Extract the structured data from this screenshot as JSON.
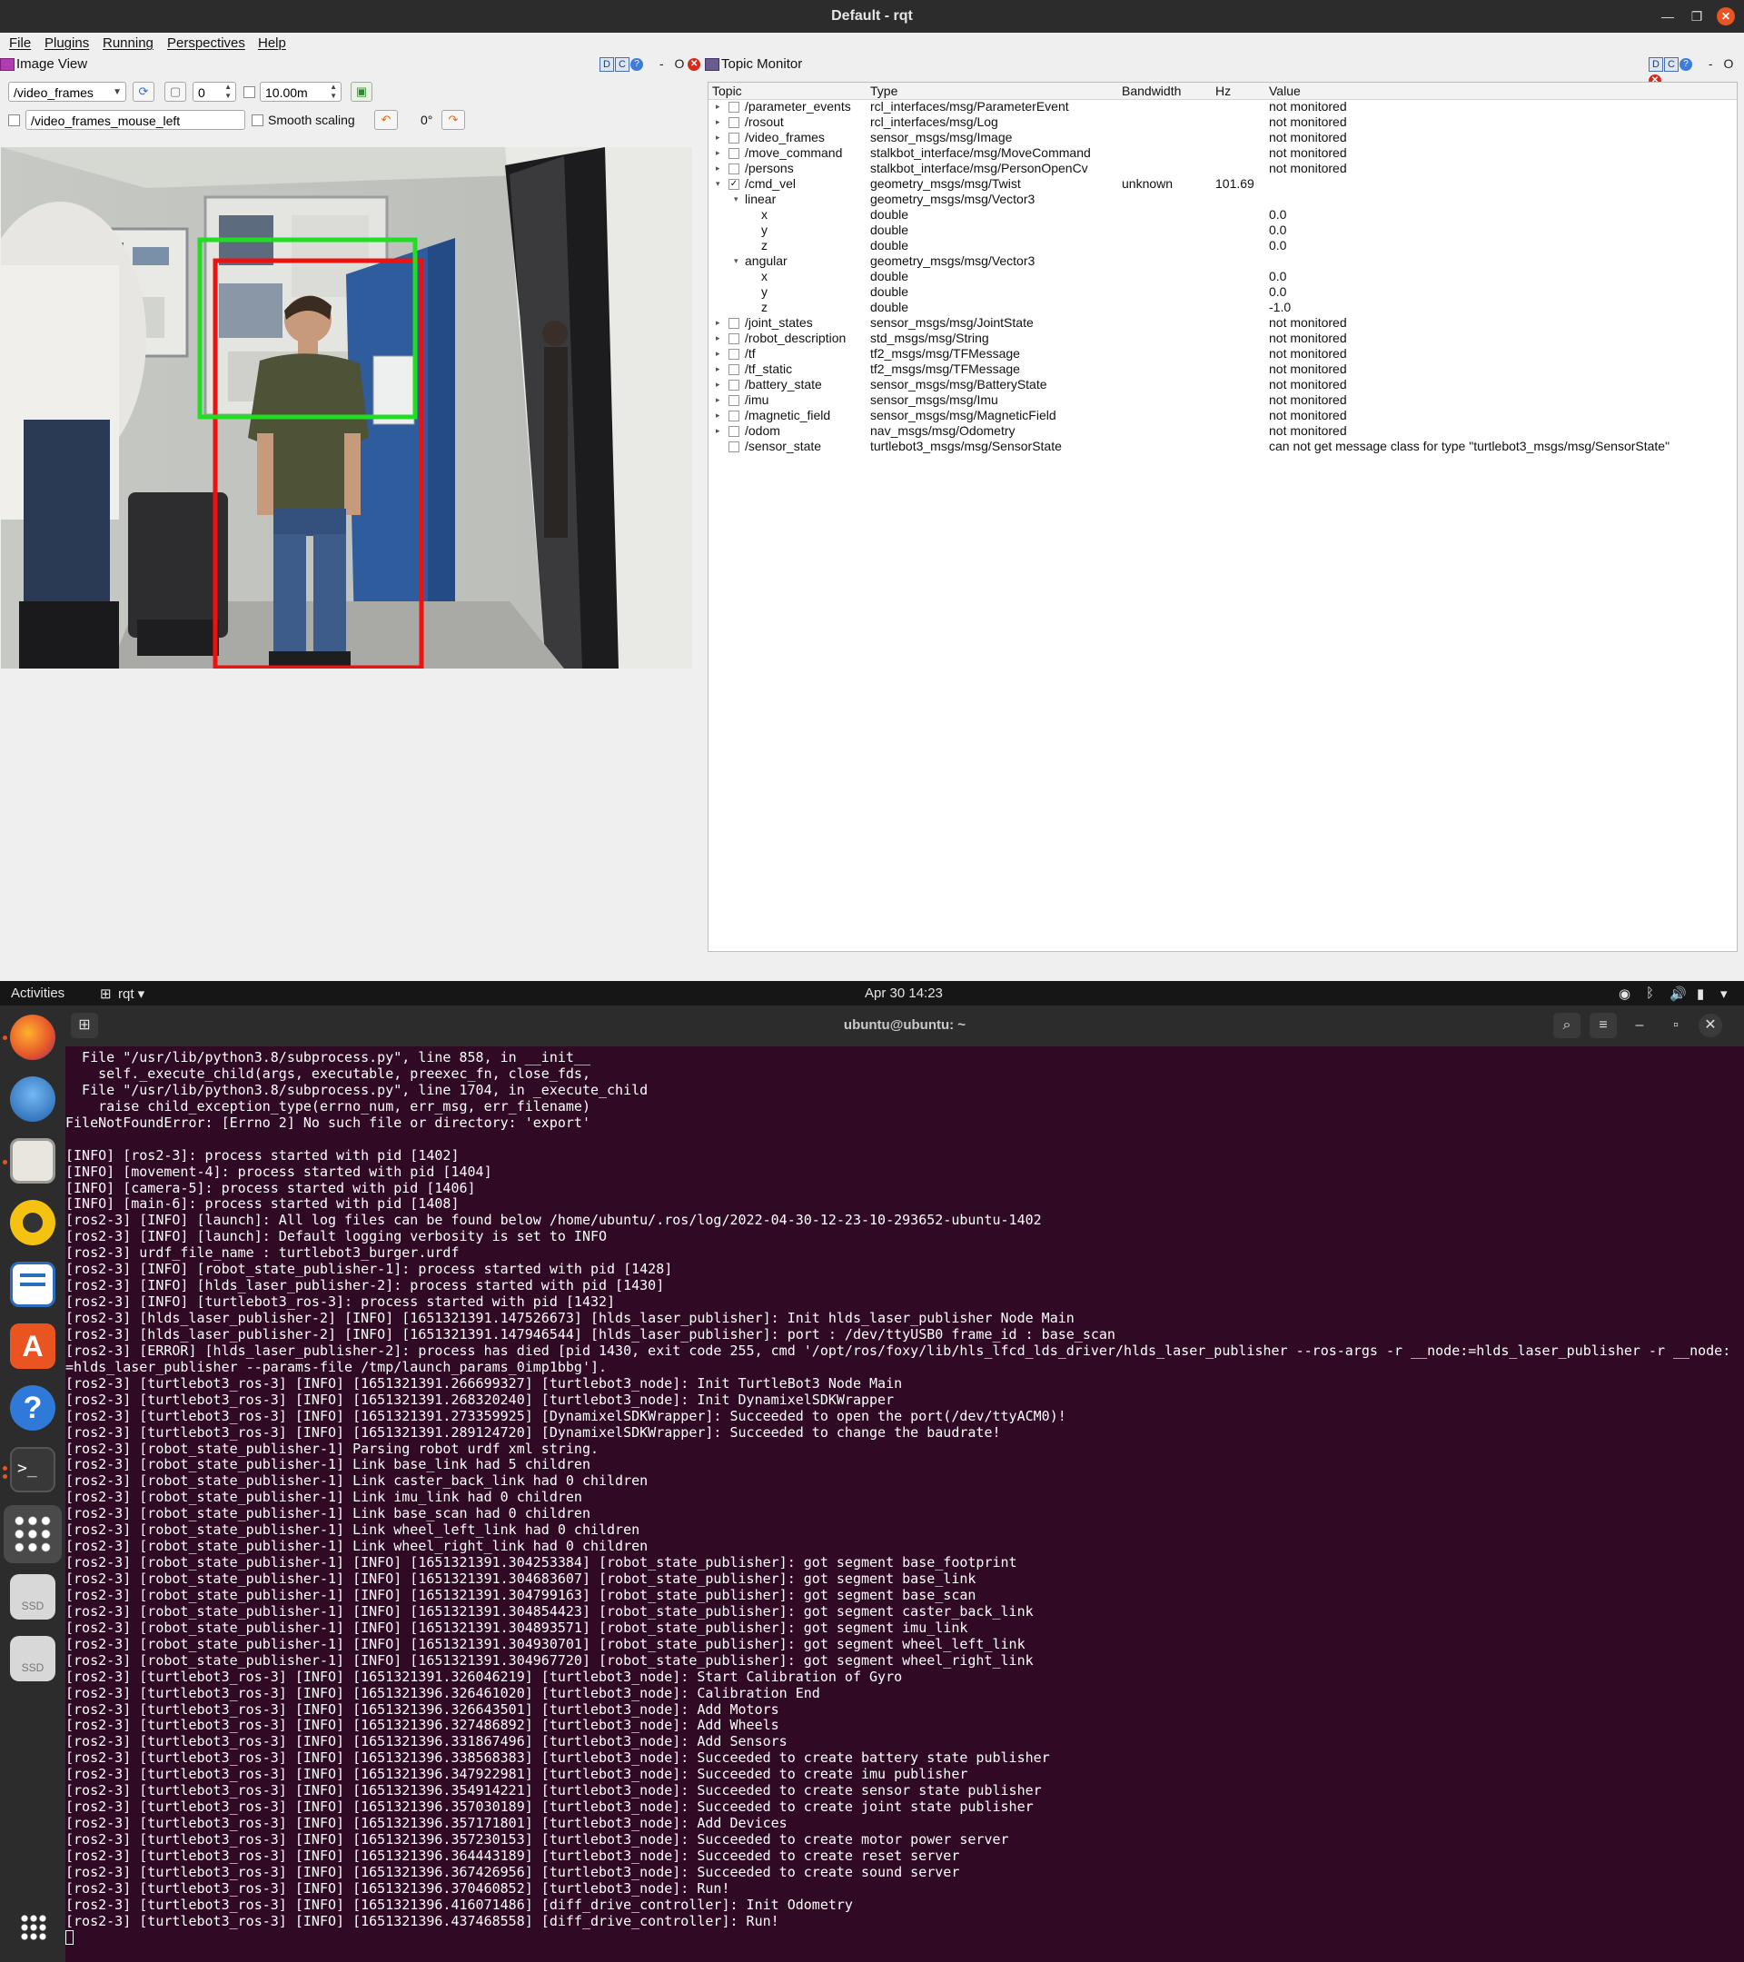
{
  "rqt": {
    "title": "Default - rqt",
    "menu": [
      "File",
      "Plugins",
      "Running",
      "Perspectives",
      "Help"
    ],
    "image_view": {
      "title": "Image View",
      "dock_controls": [
        "D",
        "C",
        "?",
        "-",
        "O"
      ],
      "topic_select": "/video_frames",
      "spin_value": "0",
      "max_range": "10.00m",
      "mouse_topic": "/video_frames_mouse_left",
      "smooth_scaling_label": "Smooth scaling",
      "rotation_label": "0°"
    },
    "topic_monitor": {
      "title": "Topic Monitor",
      "dock_controls": [
        "D",
        "C",
        "?",
        "-",
        "O"
      ],
      "columns": [
        "Topic",
        "Type",
        "Bandwidth",
        "Hz",
        "Value"
      ],
      "rows": [
        {
          "level": 0,
          "expander": "▸",
          "checked": false,
          "topic": "/parameter_events",
          "type": "rcl_interfaces/msg/ParameterEvent",
          "bandwidth": "",
          "hz": "",
          "value": "not monitored"
        },
        {
          "level": 0,
          "expander": "▸",
          "checked": false,
          "topic": "/rosout",
          "type": "rcl_interfaces/msg/Log",
          "bandwidth": "",
          "hz": "",
          "value": "not monitored"
        },
        {
          "level": 0,
          "expander": "▸",
          "checked": false,
          "topic": "/video_frames",
          "type": "sensor_msgs/msg/Image",
          "bandwidth": "",
          "hz": "",
          "value": "not monitored"
        },
        {
          "level": 0,
          "expander": "▸",
          "checked": false,
          "topic": "/move_command",
          "type": "stalkbot_interface/msg/MoveCommand",
          "bandwidth": "",
          "hz": "",
          "value": "not monitored"
        },
        {
          "level": 0,
          "expander": "▸",
          "checked": false,
          "topic": "/persons",
          "type": "stalkbot_interface/msg/PersonOpenCv",
          "bandwidth": "",
          "hz": "",
          "value": "not monitored"
        },
        {
          "level": 0,
          "expander": "▾",
          "checked": true,
          "topic": "/cmd_vel",
          "type": "geometry_msgs/msg/Twist",
          "bandwidth": "unknown",
          "hz": "101.69",
          "value": ""
        },
        {
          "level": 1,
          "expander": "▾",
          "checked": null,
          "topic": "linear",
          "type": "geometry_msgs/msg/Vector3",
          "bandwidth": "",
          "hz": "",
          "value": ""
        },
        {
          "level": 2,
          "expander": "",
          "checked": null,
          "topic": "x",
          "type": "double",
          "bandwidth": "",
          "hz": "",
          "value": "0.0"
        },
        {
          "level": 2,
          "expander": "",
          "checked": null,
          "topic": "y",
          "type": "double",
          "bandwidth": "",
          "hz": "",
          "value": "0.0"
        },
        {
          "level": 2,
          "expander": "",
          "checked": null,
          "topic": "z",
          "type": "double",
          "bandwidth": "",
          "hz": "",
          "value": "0.0"
        },
        {
          "level": 1,
          "expander": "▾",
          "checked": null,
          "topic": "angular",
          "type": "geometry_msgs/msg/Vector3",
          "bandwidth": "",
          "hz": "",
          "value": ""
        },
        {
          "level": 2,
          "expander": "",
          "checked": null,
          "topic": "x",
          "type": "double",
          "bandwidth": "",
          "hz": "",
          "value": "0.0"
        },
        {
          "level": 2,
          "expander": "",
          "checked": null,
          "topic": "y",
          "type": "double",
          "bandwidth": "",
          "hz": "",
          "value": "0.0"
        },
        {
          "level": 2,
          "expander": "",
          "checked": null,
          "topic": "z",
          "type": "double",
          "bandwidth": "",
          "hz": "",
          "value": "-1.0"
        },
        {
          "level": 0,
          "expander": "▸",
          "checked": false,
          "topic": "/joint_states",
          "type": "sensor_msgs/msg/JointState",
          "bandwidth": "",
          "hz": "",
          "value": "not monitored"
        },
        {
          "level": 0,
          "expander": "▸",
          "checked": false,
          "topic": "/robot_description",
          "type": "std_msgs/msg/String",
          "bandwidth": "",
          "hz": "",
          "value": "not monitored"
        },
        {
          "level": 0,
          "expander": "▸",
          "checked": false,
          "topic": "/tf",
          "type": "tf2_msgs/msg/TFMessage",
          "bandwidth": "",
          "hz": "",
          "value": "not monitored"
        },
        {
          "level": 0,
          "expander": "▸",
          "checked": false,
          "topic": "/tf_static",
          "type": "tf2_msgs/msg/TFMessage",
          "bandwidth": "",
          "hz": "",
          "value": "not monitored"
        },
        {
          "level": 0,
          "expander": "▸",
          "checked": false,
          "topic": "/battery_state",
          "type": "sensor_msgs/msg/BatteryState",
          "bandwidth": "",
          "hz": "",
          "value": "not monitored"
        },
        {
          "level": 0,
          "expander": "▸",
          "checked": false,
          "topic": "/imu",
          "type": "sensor_msgs/msg/Imu",
          "bandwidth": "",
          "hz": "",
          "value": "not monitored"
        },
        {
          "level": 0,
          "expander": "▸",
          "checked": false,
          "topic": "/magnetic_field",
          "type": "sensor_msgs/msg/MagneticField",
          "bandwidth": "",
          "hz": "",
          "value": "not monitored"
        },
        {
          "level": 0,
          "expander": "▸",
          "checked": false,
          "topic": "/odom",
          "type": "nav_msgs/msg/Odometry",
          "bandwidth": "",
          "hz": "",
          "value": "not monitored"
        },
        {
          "level": 0,
          "expander": "",
          "checked": false,
          "topic": "/sensor_state",
          "type": "turtlebot3_msgs/msg/SensorState",
          "bandwidth": "",
          "hz": "",
          "value": "can not get message class for type \"turtlebot3_msgs/msg/SensorState\""
        }
      ]
    }
  },
  "top_panel": {
    "activities": "Activities",
    "app_menu": "rqt ▾",
    "clock": "Apr 30  14:23",
    "tray_icons": [
      "wifi-icon",
      "bluetooth-icon",
      "volume-icon",
      "battery-icon",
      "system-menu-icon"
    ]
  },
  "dock": {
    "apps": [
      "firefox-icon",
      "thunderbird-icon",
      "files-icon",
      "rhythmbox-icon",
      "writer-icon",
      "software-icon",
      "help-icon",
      "terminal-icon",
      "show-apps-icon",
      "drive-icon",
      "drive-icon"
    ],
    "drive_label": "SSD"
  },
  "terminal": {
    "title": "ubuntu@ubuntu: ~",
    "lines": [
      "  File \"/usr/lib/python3.8/subprocess.py\", line 858, in __init__",
      "    self._execute_child(args, executable, preexec_fn, close_fds,",
      "  File \"/usr/lib/python3.8/subprocess.py\", line 1704, in _execute_child",
      "    raise child_exception_type(errno_num, err_msg, err_filename)",
      "FileNotFoundError: [Errno 2] No such file or directory: 'export'",
      "",
      "[INFO] [ros2-3]: process started with pid [1402]",
      "[INFO] [movement-4]: process started with pid [1404]",
      "[INFO] [camera-5]: process started with pid [1406]",
      "[INFO] [main-6]: process started with pid [1408]",
      "[ros2-3] [INFO] [launch]: All log files can be found below /home/ubuntu/.ros/log/2022-04-30-12-23-10-293652-ubuntu-1402",
      "[ros2-3] [INFO] [launch]: Default logging verbosity is set to INFO",
      "[ros2-3] urdf_file_name : turtlebot3_burger.urdf",
      "[ros2-3] [INFO] [robot_state_publisher-1]: process started with pid [1428]",
      "[ros2-3] [INFO] [hlds_laser_publisher-2]: process started with pid [1430]",
      "[ros2-3] [INFO] [turtlebot3_ros-3]: process started with pid [1432]",
      "[ros2-3] [hlds_laser_publisher-2] [INFO] [1651321391.147526673] [hlds_laser_publisher]: Init hlds_laser_publisher Node Main",
      "[ros2-3] [hlds_laser_publisher-2] [INFO] [1651321391.147946544] [hlds_laser_publisher]: port : /dev/ttyUSB0 frame_id : base_scan",
      "[ros2-3] [ERROR] [hlds_laser_publisher-2]: process has died [pid 1430, exit code 255, cmd '/opt/ros/foxy/lib/hls_lfcd_lds_driver/hlds_laser_publisher --ros-args -r __node:=hlds_laser_publisher -r __node:",
      "=hlds_laser_publisher --params-file /tmp/launch_params_0imp1bbg'].",
      "[ros2-3] [turtlebot3_ros-3] [INFO] [1651321391.266699327] [turtlebot3_node]: Init TurtleBot3 Node Main",
      "[ros2-3] [turtlebot3_ros-3] [INFO] [1651321391.268320240] [turtlebot3_node]: Init DynamixelSDKWrapper",
      "[ros2-3] [turtlebot3_ros-3] [INFO] [1651321391.273359925] [DynamixelSDKWrapper]: Succeeded to open the port(/dev/ttyACM0)!",
      "[ros2-3] [turtlebot3_ros-3] [INFO] [1651321391.289124720] [DynamixelSDKWrapper]: Succeeded to change the baudrate!",
      "[ros2-3] [robot_state_publisher-1] Parsing robot urdf xml string.",
      "[ros2-3] [robot_state_publisher-1] Link base_link had 5 children",
      "[ros2-3] [robot_state_publisher-1] Link caster_back_link had 0 children",
      "[ros2-3] [robot_state_publisher-1] Link imu_link had 0 children",
      "[ros2-3] [robot_state_publisher-1] Link base_scan had 0 children",
      "[ros2-3] [robot_state_publisher-1] Link wheel_left_link had 0 children",
      "[ros2-3] [robot_state_publisher-1] Link wheel_right_link had 0 children",
      "[ros2-3] [robot_state_publisher-1] [INFO] [1651321391.304253384] [robot_state_publisher]: got segment base_footprint",
      "[ros2-3] [robot_state_publisher-1] [INFO] [1651321391.304683607] [robot_state_publisher]: got segment base_link",
      "[ros2-3] [robot_state_publisher-1] [INFO] [1651321391.304799163] [robot_state_publisher]: got segment base_scan",
      "[ros2-3] [robot_state_publisher-1] [INFO] [1651321391.304854423] [robot_state_publisher]: got segment caster_back_link",
      "[ros2-3] [robot_state_publisher-1] [INFO] [1651321391.304893571] [robot_state_publisher]: got segment imu_link",
      "[ros2-3] [robot_state_publisher-1] [INFO] [1651321391.304930701] [robot_state_publisher]: got segment wheel_left_link",
      "[ros2-3] [robot_state_publisher-1] [INFO] [1651321391.304967720] [robot_state_publisher]: got segment wheel_right_link",
      "[ros2-3] [turtlebot3_ros-3] [INFO] [1651321391.326046219] [turtlebot3_node]: Start Calibration of Gyro",
      "[ros2-3] [turtlebot3_ros-3] [INFO] [1651321396.326461020] [turtlebot3_node]: Calibration End",
      "[ros2-3] [turtlebot3_ros-3] [INFO] [1651321396.326643501] [turtlebot3_node]: Add Motors",
      "[ros2-3] [turtlebot3_ros-3] [INFO] [1651321396.327486892] [turtlebot3_node]: Add Wheels",
      "[ros2-3] [turtlebot3_ros-3] [INFO] [1651321396.331867496] [turtlebot3_node]: Add Sensors",
      "[ros2-3] [turtlebot3_ros-3] [INFO] [1651321396.338568383] [turtlebot3_node]: Succeeded to create battery state publisher",
      "[ros2-3] [turtlebot3_ros-3] [INFO] [1651321396.347922981] [turtlebot3_node]: Succeeded to create imu publisher",
      "[ros2-3] [turtlebot3_ros-3] [INFO] [1651321396.354914221] [turtlebot3_node]: Succeeded to create sensor state publisher",
      "[ros2-3] [turtlebot3_ros-3] [INFO] [1651321396.357030189] [turtlebot3_node]: Succeeded to create joint state publisher",
      "[ros2-3] [turtlebot3_ros-3] [INFO] [1651321396.357171801] [turtlebot3_node]: Add Devices",
      "[ros2-3] [turtlebot3_ros-3] [INFO] [1651321396.357230153] [turtlebot3_node]: Succeeded to create motor power server",
      "[ros2-3] [turtlebot3_ros-3] [INFO] [1651321396.364443189] [turtlebot3_node]: Succeeded to create reset server",
      "[ros2-3] [turtlebot3_ros-3] [INFO] [1651321396.367426956] [turtlebot3_node]: Succeeded to create sound server",
      "[ros2-3] [turtlebot3_ros-3] [INFO] [1651321396.370460852] [turtlebot3_node]: Run!",
      "[ros2-3] [turtlebot3_ros-3] [INFO] [1651321396.416071486] [diff_drive_controller]: Init Odometry",
      "[ros2-3] [turtlebot3_ros-3] [INFO] [1651321396.437468558] [diff_drive_controller]: Run!"
    ]
  },
  "colors": {
    "terminal_bg": "#300a24",
    "accent": "#e95420",
    "bbox_head": "#22dd22",
    "bbox_body": "#ee1111"
  }
}
